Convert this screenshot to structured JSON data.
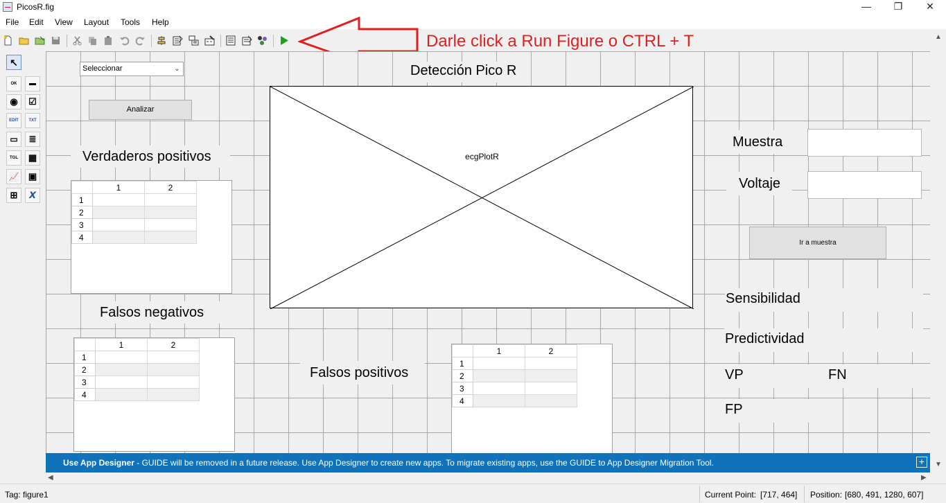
{
  "window": {
    "title": "PicosR.fig",
    "controls": [
      "—",
      "❐",
      "✕"
    ]
  },
  "menu": [
    "File",
    "Edit",
    "View",
    "Layout",
    "Tools",
    "Help"
  ],
  "toolbar": {
    "icons": [
      "new-file-icon",
      "open-folder-icon",
      "save-as-icon",
      "save-icon",
      "cut-icon",
      "copy-icon",
      "paste-icon",
      "undo-icon",
      "redo-icon",
      "align-objects-icon",
      "menu-editor-icon",
      "tab-order-editor-icon",
      "toolbar-editor-icon",
      "editor-icon",
      "property-inspector-icon",
      "object-browser-icon",
      "run-figure-icon"
    ]
  },
  "annotation": {
    "text": "Darle click a Run Figure o CTRL + T",
    "color": "#e02020"
  },
  "palette": [
    "↖",
    "OK",
    "▬",
    "◉",
    "☑",
    "EDIT",
    "TXT",
    "▭",
    "≣",
    "TGL",
    "▦",
    "📈",
    "▣",
    "⊞",
    "𝙓"
  ],
  "layout_editor": {
    "popup": {
      "value": "Seleccionar"
    },
    "analizar_button": "Analizar",
    "title_label": "Detección Pico R",
    "axes_tag": "ecgPlotR",
    "labels": {
      "verdaderos_positivos": "Verdaderos positivos",
      "falsos_negativos": "Falsos negativos",
      "falsos_positivos": "Falsos positivos",
      "muestra": "Muestra",
      "voltaje": "Voltaje",
      "sensibilidad": "Sensibilidad",
      "predictividad": "Predictividad",
      "vp": "VP",
      "fn": "FN",
      "fp": "FP"
    },
    "ir_a_muestra_button": "Ir a muestra",
    "table": {
      "columns": [
        "1",
        "2"
      ],
      "rows": [
        "1",
        "2",
        "3",
        "4"
      ]
    }
  },
  "banner": {
    "bold": "Use App Designer",
    "text": " - GUIDE will be removed in a future release. Use App Designer to create new apps. To migrate existing apps, use the GUIDE to App Designer Migration Tool.",
    "plus": "+"
  },
  "status": {
    "tag": "Tag: figure1",
    "current_point_label": "Current Point:",
    "current_point": "[717, 464]",
    "position_label": "Position:",
    "position": "[680, 491, 1280, 607]"
  }
}
